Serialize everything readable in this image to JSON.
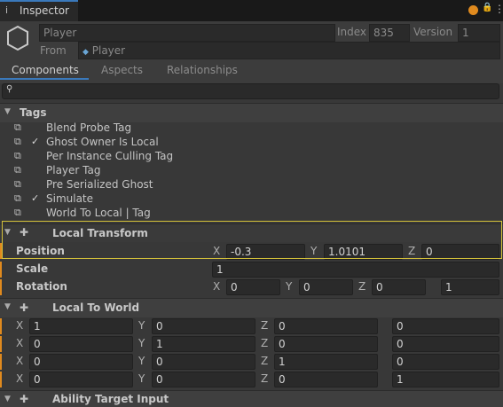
{
  "window": {
    "tab_label": "Inspector",
    "tab_icon": "i",
    "lock_icon": "🔒",
    "menu_icon": "⋮",
    "dot_color": "#e08a1e"
  },
  "entity": {
    "name_placeholder": "Player",
    "index_label": "Index",
    "index_value": "835",
    "version_label": "Version",
    "version_value": "1",
    "from_label": "From",
    "from_value": "Player"
  },
  "subtabs": [
    "Components",
    "Aspects",
    "Relationships"
  ],
  "search": {
    "placeholder": ""
  },
  "tags": {
    "title": "Tags",
    "items": [
      {
        "label": "Blend Probe Tag",
        "checked": false
      },
      {
        "label": "Ghost Owner Is Local",
        "checked": true
      },
      {
        "label": "Per Instance Culling Tag",
        "checked": false
      },
      {
        "label": "Player Tag",
        "checked": false
      },
      {
        "label": "Pre Serialized Ghost",
        "checked": false
      },
      {
        "label": "Simulate",
        "checked": true
      },
      {
        "label": "World To Local | Tag",
        "checked": false
      }
    ]
  },
  "local_transform": {
    "title": "Local Transform",
    "position_label": "Position",
    "position": {
      "x": "-0.3",
      "y": "1.0101",
      "z": "0"
    },
    "scale_label": "Scale",
    "scale": "1",
    "rotation_label": "Rotation",
    "rotation": {
      "x": "0",
      "y": "0",
      "z": "0",
      "w": "1"
    }
  },
  "local_to_world": {
    "title": "Local To World",
    "rows": [
      {
        "x": "1",
        "y": "0",
        "z": "0",
        "w": "0"
      },
      {
        "x": "0",
        "y": "1",
        "z": "0",
        "w": "0"
      },
      {
        "x": "0",
        "y": "0",
        "z": "1",
        "w": "0"
      },
      {
        "x": "0",
        "y": "0",
        "z": "0",
        "w": "1"
      }
    ]
  },
  "ability_target_input": {
    "title": "Ability Target Input"
  },
  "axis_labels": {
    "x": "X",
    "y": "Y",
    "z": "Z"
  }
}
